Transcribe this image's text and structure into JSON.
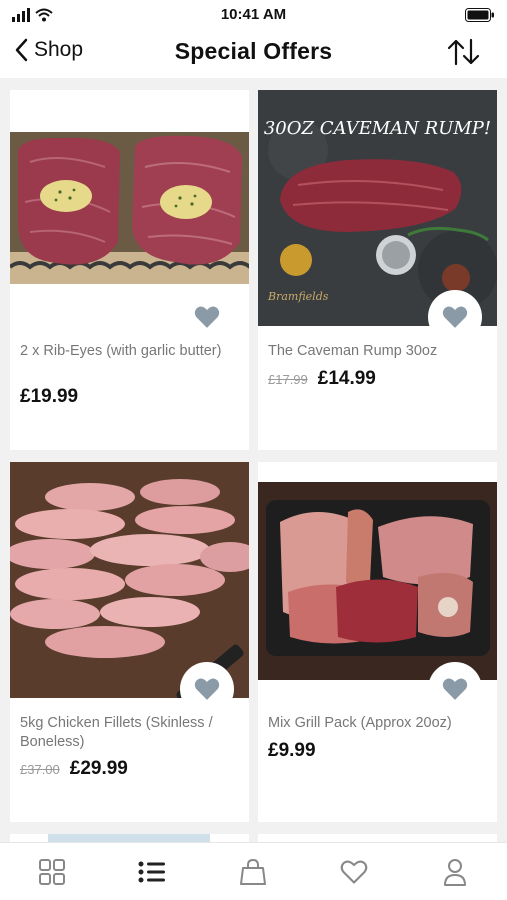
{
  "status_bar": {
    "time": "10:41 AM"
  },
  "nav": {
    "back_label": "Shop",
    "title": "Special Offers"
  },
  "products": [
    {
      "name": "2 x Rib-Eyes (with garlic butter)",
      "old_price": "",
      "price": "£19.99"
    },
    {
      "name": "The Caveman Rump 30oz",
      "old_price": "£17.99",
      "price": "£14.99",
      "image_caption": "30OZ CAVEMAN RUMP!"
    },
    {
      "name": "5kg Chicken Fillets (Skinless / Boneless)",
      "old_price": "£37.00",
      "price": "£29.99"
    },
    {
      "name": "Mix Grill Pack (Approx 20oz)",
      "old_price": "",
      "price": "£9.99"
    }
  ],
  "colors": {
    "heart": "#8a9aa6",
    "active_tab": "#222222",
    "inactive_tab": "#888888"
  },
  "tabbar": {
    "icons": [
      "grid-icon",
      "list-icon",
      "bag-icon",
      "heart-icon",
      "user-icon"
    ],
    "active": "list-icon"
  }
}
